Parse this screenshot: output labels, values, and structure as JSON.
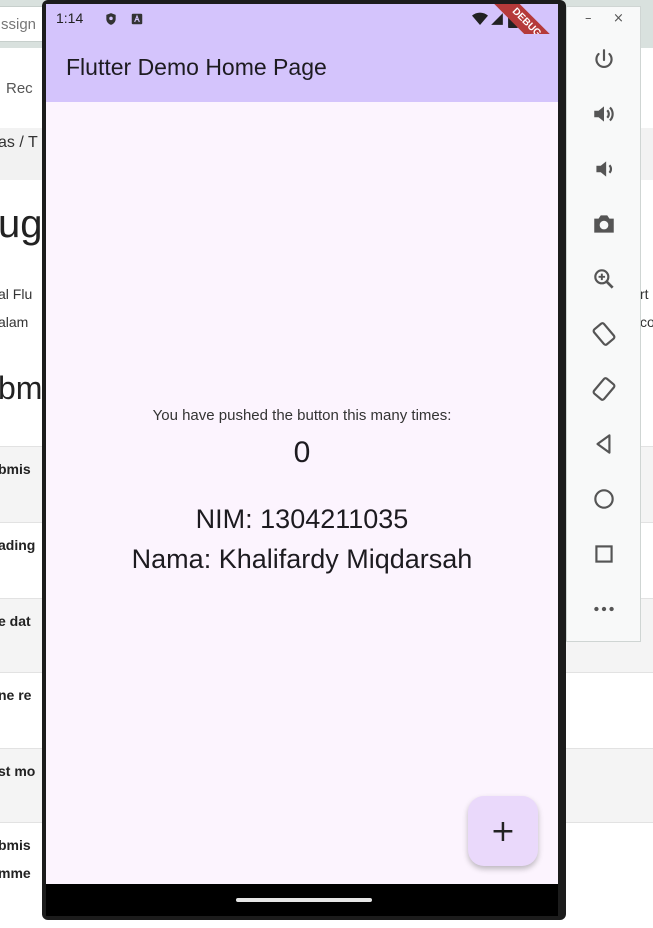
{
  "background": {
    "search_text": "ssign",
    "recent_text": "Rec",
    "crumb_text": "as / T",
    "heading_text": "ugo",
    "desc_line1": "al Flu",
    "desc_line2": "alam",
    "desc_right1": "rt",
    "desc_right2": "co",
    "subheading_text": "bm",
    "rows": [
      {
        "label": "bmis"
      },
      {
        "label": "ading"
      },
      {
        "label": "e dat"
      },
      {
        "label": "ne re"
      },
      {
        "label": "st mo"
      },
      {
        "label": "bmis"
      },
      {
        "label": "mme"
      }
    ]
  },
  "status_bar": {
    "time": "1:14"
  },
  "app_bar": {
    "title": "Flutter Demo Home Page"
  },
  "debug_banner": "DEBUG",
  "body": {
    "counter_label": "You have pushed the button this many times:",
    "counter_value": "0",
    "nim": "NIM: 1304211035",
    "nama": "Nama: Khalifardy Miqdarsah"
  },
  "fab": {
    "label": "+"
  },
  "emulator_panel": {
    "minimize": "–",
    "close": "×",
    "buttons": [
      "power-icon",
      "volume-up-icon",
      "volume-down-icon",
      "camera-icon",
      "zoom-icon",
      "rotate-left-icon",
      "rotate-right-icon",
      "back-icon",
      "home-icon",
      "overview-icon",
      "more-icon"
    ]
  },
  "colors": {
    "app_bar": "#d4c4fc",
    "screen_bg": "#fcf4fe",
    "fab_bg": "#ead9fb",
    "debug_banner": "#b53a3a"
  }
}
